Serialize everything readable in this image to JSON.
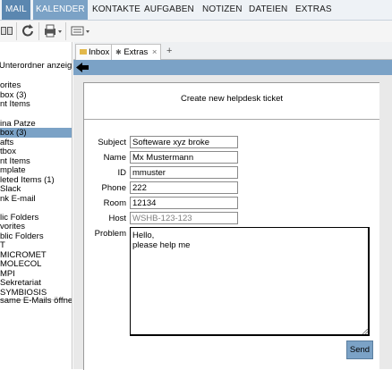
{
  "nav": [
    "MAIL",
    "KALENDER",
    "KONTAKTE",
    "AUFGABEN",
    "NOTIZEN",
    "DATEIEN",
    "EXTRAS"
  ],
  "sidebar": {
    "unterordner": "Unterordner anzeigen",
    "lines": [
      "orites",
      "box (3)",
      "nt Items",
      "",
      "ina Patze",
      "box (3)",
      "afts",
      "tbox",
      "nt Items",
      "mplate",
      "leted Items (1)",
      "Slack",
      "nk E-mail",
      "",
      "lic Folders",
      "vorites",
      "blic Folders",
      "T",
      "MICROMET",
      "MOLECOL",
      "MPI",
      "Sekretariat",
      "SYMBIOSIS"
    ],
    "footer": "same E-Mails öffne"
  },
  "tabs": [
    {
      "label": "Inbox"
    },
    {
      "label": "Extras",
      "close": "×"
    },
    {
      "label": "+"
    }
  ],
  "form": {
    "title": "Create new helpdesk ticket",
    "subject_label": "Subject",
    "subject_value": "Softeware xyz broke",
    "name_label": "Name",
    "name_value": "Mx Mustermann",
    "id_label": "ID",
    "id_value": "mmuster",
    "phone_label": "Phone",
    "phone_value": "222",
    "room_label": "Room",
    "room_value": "12134",
    "host_label": "Host",
    "host_placeholder": "WSHB-123-123",
    "problem_label": "Problem",
    "problem_line1": "Hello,",
    "problem_line2": "please help me",
    "send_label": "Send"
  }
}
